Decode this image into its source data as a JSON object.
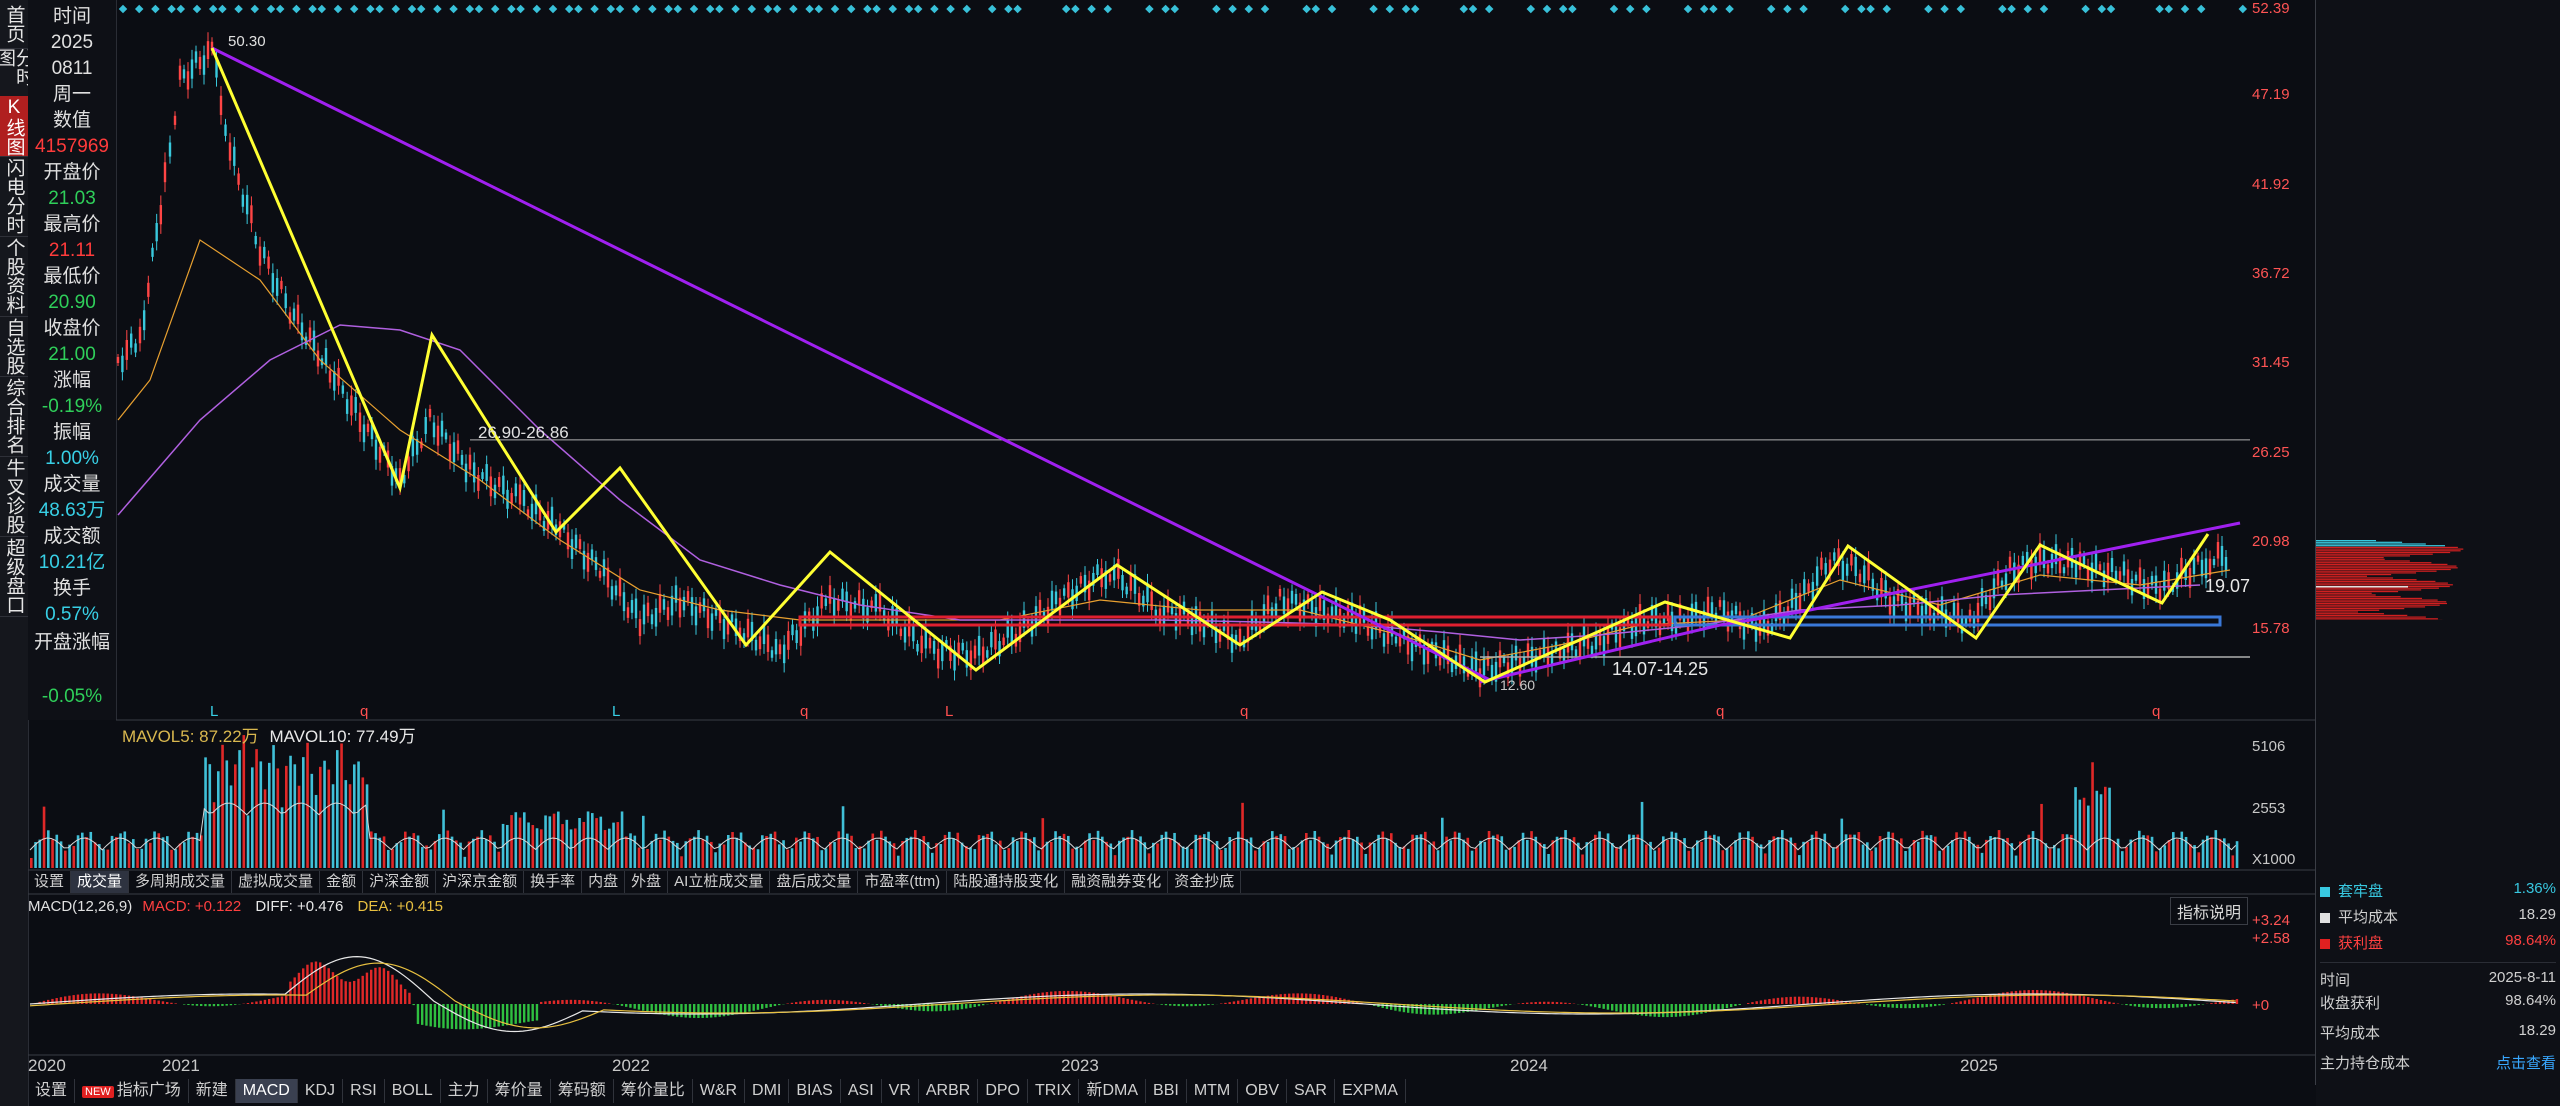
{
  "vtabs": [
    {
      "label": "首页",
      "active": false
    },
    {
      "label": "分时图",
      "active": false
    },
    {
      "label": "K线图",
      "active": true
    },
    {
      "label": "闪电分时",
      "active": false
    },
    {
      "label": "个股资料",
      "active": false
    },
    {
      "label": "自选股",
      "active": false
    },
    {
      "label": "综合排名",
      "active": false
    },
    {
      "label": "牛叉诊股",
      "active": false
    },
    {
      "label": "超级盘口",
      "active": false
    }
  ],
  "info": {
    "time_label": "时间",
    "year": "2025",
    "date": "0811",
    "weekday": "周一",
    "value_label": "数值",
    "value": "4157969",
    "open_label": "开盘价",
    "open": "21.03",
    "high_label": "最高价",
    "high": "21.11",
    "low_label": "最低价",
    "low": "20.90",
    "close_label": "收盘价",
    "close": "21.00",
    "change_label": "涨幅",
    "change": "-0.19%",
    "amplitude_label": "振幅",
    "amplitude": "1.00%",
    "volume_label": "成交量",
    "volume": "48.63万",
    "amount_label": "成交额",
    "amount": "10.21亿",
    "turnover_label": "换手",
    "turnover": "0.57%",
    "open_change_label": "开盘涨幅",
    "open_change": "-0.05%"
  },
  "price_axis": [
    "52.39",
    "47.19",
    "41.92",
    "36.72",
    "31.45",
    "26.25",
    "20.98",
    "15.78"
  ],
  "annotations": {
    "peak": "50.30",
    "range1": "26.90-26.86",
    "range2": "14.07-14.25",
    "low": "12.60",
    "current": "19.07"
  },
  "event_markers": [
    {
      "text": "L",
      "color": "#38d0e6"
    },
    {
      "text": "q",
      "color": "#ff5050"
    },
    {
      "text": "L",
      "color": "#38d0e6"
    },
    {
      "text": "q",
      "color": "#ff5050"
    },
    {
      "text": "L",
      "color": "#ff5050"
    },
    {
      "text": "q",
      "color": "#ff5050"
    },
    {
      "text": "q",
      "color": "#ff5050"
    },
    {
      "text": "q",
      "color": "#ff5050"
    }
  ],
  "volume_legend": {
    "mavol5": "MAVOL5: 87.22万",
    "mavol10": "MAVOL10: 77.49万"
  },
  "volume_axis": [
    "5106",
    "2553",
    "X1000"
  ],
  "subtabs": [
    "设置",
    "成交量",
    "多周期成交量",
    "虚拟成交量",
    "金额",
    "沪深金额",
    "沪深京金额",
    "换手率",
    "内盘",
    "外盘",
    "AI立桩成交量",
    "盘后成交量",
    "市盈率(ttm)",
    "陆股通持股变化",
    "融资融券变化",
    "资金抄底"
  ],
  "subtab_active": 1,
  "macd_legend": {
    "name": "MACD(12,26,9)",
    "macd": "MACD: +0.122",
    "diff": "DIFF: +0.476",
    "dea": "DEA: +0.415"
  },
  "indicator_help": "指标说明",
  "macd_axis": [
    "+3.24",
    "+2.58",
    "+0"
  ],
  "years": [
    "2020",
    "2021",
    "2022",
    "2023",
    "2024",
    "2025"
  ],
  "bottom_tabs": [
    "设置",
    "指标广场",
    "新建",
    "MACD",
    "KDJ",
    "RSI",
    "BOLL",
    "主力",
    "筹价量",
    "筹码额",
    "筹价量比",
    "W&R",
    "DMI",
    "BIAS",
    "ASI",
    "VR",
    "ARBR",
    "DPO",
    "TRIX",
    "新DMA",
    "BBI",
    "MTM",
    "OBV",
    "SAR",
    "EXPMA"
  ],
  "bottom_active": 3,
  "right_panel": {
    "legend": [
      {
        "label": "套牢盘",
        "value": "1.36%",
        "color": "#38c8e0"
      },
      {
        "label": "平均成本",
        "value": "18.29",
        "color": "#e0e0e0"
      },
      {
        "label": "获利盘",
        "value": "98.64%",
        "color": "#e02020"
      }
    ],
    "time_label": "时间",
    "time": "2025-8-11",
    "profit_label": "收盘获利",
    "profit": "98.64%",
    "avg_label": "平均成本",
    "avg": "18.29",
    "main_label": "主力持仓成本",
    "main_link": "点击查看"
  },
  "colors": {
    "up": "#ff3b3b",
    "down": "#2fcf5a",
    "zigzag": "#ffff33",
    "trend": "#a020f0",
    "support": "#e02030",
    "box": "#3a78d8"
  }
}
